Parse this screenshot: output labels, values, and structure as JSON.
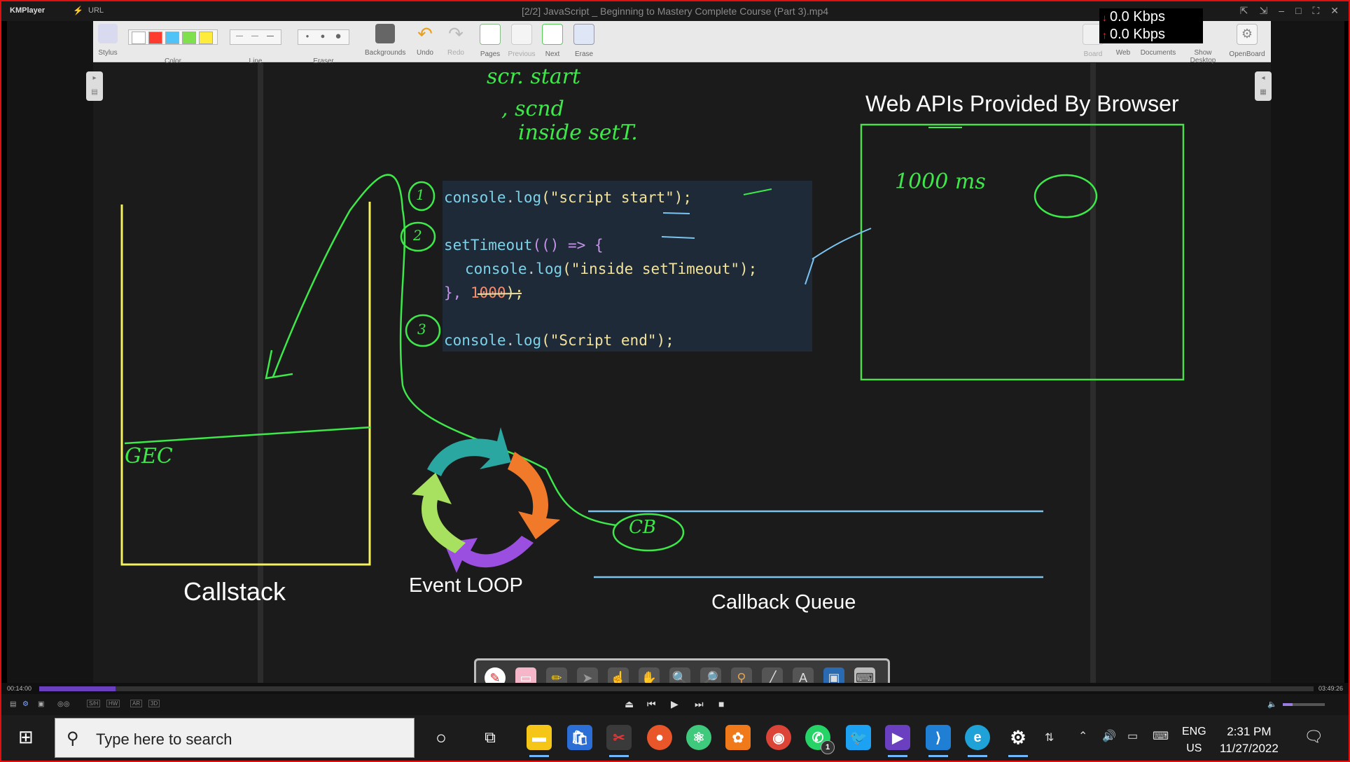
{
  "window": {
    "app_name": "KMPlayer",
    "url_label": "URL",
    "title": "[2/2] JavaScript _ Beginning to Mastery Complete Course (Part 3).mp4",
    "net_down": "0.0 Kbps",
    "net_up": "0.0 Kbps"
  },
  "toolbar": {
    "items": [
      {
        "label": "Stylus"
      },
      {
        "label": "Color"
      },
      {
        "label": "Line"
      },
      {
        "label": "Eraser"
      },
      {
        "label": "Backgrounds"
      },
      {
        "label": "Undo"
      },
      {
        "label": "Redo"
      },
      {
        "label": "Pages"
      },
      {
        "label": "Previous"
      },
      {
        "label": "Next"
      },
      {
        "label": "Erase"
      },
      {
        "label": "Board"
      },
      {
        "label": "Web"
      },
      {
        "label": "Documents"
      },
      {
        "label": "Show Desktop"
      },
      {
        "label": "OpenBoard"
      }
    ],
    "colors": [
      "#ffffff",
      "#ff3b2f",
      "#4fc3f7",
      "#7ee04d",
      "#ffeb3b"
    ]
  },
  "slide": {
    "code": {
      "line1": [
        "console",
        ".",
        "log",
        "(",
        "\"script start\"",
        ");"
      ],
      "line2": [
        "setTimeout",
        "((",
        ") => {"
      ],
      "line3": [
        "console",
        ".",
        "log",
        "(",
        "\"inside setTimeout\"",
        ");"
      ],
      "line4": [
        "}, ",
        "1000",
        ");"
      ],
      "line5": [
        "console",
        ".",
        "log",
        "(",
        "\"Script end\"",
        ");"
      ]
    },
    "web_apis_title": "Web APIs Provided By Browser",
    "callstack_label": "Callstack",
    "event_loop_label": "Event LOOP",
    "callback_queue_label": "Callback Queue",
    "ink": {
      "notes1": "scr. start",
      "notes2": ", scnd",
      "notes3": "inside setT.",
      "timer": "1000 ms",
      "gec": "GEC",
      "cb": "CB",
      "n1": "1",
      "n2": "2",
      "n3": "3"
    }
  },
  "player": {
    "time_elapsed": "00:14:00",
    "time_total": "03:49:26",
    "progress": 0.06
  },
  "taskbar": {
    "search_placeholder": "Type here to search",
    "lang_top": "ENG",
    "lang_bottom": "US",
    "time": "2:31 PM",
    "date": "11/27/2022",
    "whatsapp_badge": "1"
  },
  "colors": {
    "ink_green": "#3ee84a",
    "callstack_yellow": "#f5f060",
    "queue_blue": "#7cc4f0",
    "code_bg": "#1e2a38"
  }
}
